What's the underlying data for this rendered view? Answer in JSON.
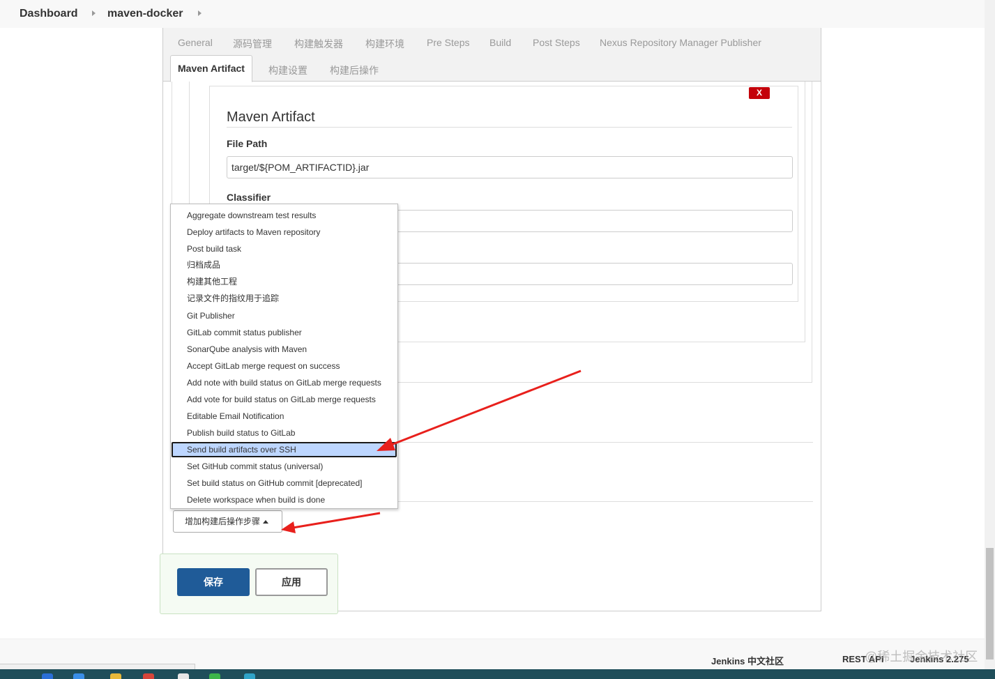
{
  "breadcrumb": {
    "dashboard": "Dashboard",
    "project": "maven-docker"
  },
  "tabs": {
    "row1": [
      "General",
      "源码管理",
      "构建触发器",
      "构建环境",
      "Pre Steps",
      "Build",
      "Post Steps",
      "Nexus Repository Manager Publisher"
    ],
    "row2": [
      "Maven Artifact",
      "构建设置",
      "构建后操作"
    ],
    "active": "Maven Artifact"
  },
  "artifact": {
    "close_label": "X",
    "title": "Maven Artifact",
    "file_path_label": "File Path",
    "file_path_value": "target/${POM_ARTIFACTID}.jar",
    "classifier_label": "Classifier",
    "classifier_value": "",
    "third_value": ""
  },
  "menu": {
    "items": [
      "Aggregate downstream test results",
      "Deploy artifacts to Maven repository",
      "Post build task",
      "归档成品",
      "构建其他工程",
      "记录文件的指纹用于追踪",
      "Git Publisher",
      "GitLab commit status publisher",
      "SonarQube analysis with Maven",
      "Accept GitLab merge request on success",
      "Add note with build status on GitLab merge requests",
      "Add vote for build status on GitLab merge requests",
      "Editable Email Notification",
      "Publish build status to GitLab",
      "Send build artifacts over SSH",
      "Set GitHub commit status (universal)",
      "Set build status on GitHub commit [deprecated]",
      "Delete workspace when build is done"
    ],
    "selected": "Send build artifacts over SSH"
  },
  "add_step_button": "增加构建后操作步骤",
  "buttons": {
    "save": "保存",
    "apply": "应用"
  },
  "footer": {
    "community": "Jenkins 中文社区",
    "rest_api": "REST API",
    "version": "Jenkins 2.275"
  },
  "watermark": "@稀土掘金技术社区",
  "colors": {
    "save_button": "#1f5b98",
    "close_button": "#c4000a",
    "menu_selected": "#bdd6ff",
    "annotation_arrow": "#e8201c",
    "taskbar": "#1f4e5a"
  }
}
